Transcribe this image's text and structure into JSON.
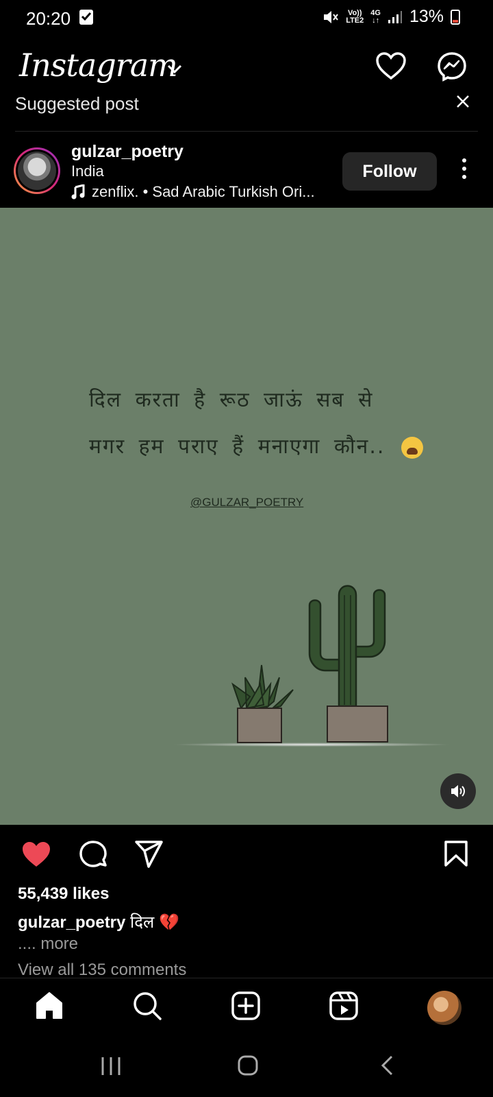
{
  "status_bar": {
    "time": "20:20",
    "network_top": "Vo))",
    "network_bottom": "LTE2",
    "network_type": "4G",
    "battery": "13%"
  },
  "header": {
    "logo": "Instagram"
  },
  "suggested": {
    "label": "Suggested post"
  },
  "post": {
    "username": "gulzar_poetry",
    "location": "India",
    "music": "zenflix. • Sad Arabic Turkish Ori...",
    "follow_label": "Follow",
    "poem_line1": "दिल करता है रूठ जाऊं सब से",
    "poem_line2": "मगर हम पराए हैं मनाएगा कौन..",
    "handle": "@GULZAR_POETRY",
    "likes": "55,439 likes",
    "caption_user": "gulzar_poetry",
    "caption_text": "दिल 💔",
    "more": ".... more",
    "comments": "View all 135 comments",
    "liked": true
  },
  "colors": {
    "post_bg": "#6b7f69",
    "like_red": "#ed4956",
    "follow_bg": "#262626"
  },
  "bottom_nav": {
    "items": [
      "home-icon",
      "search-icon",
      "create-icon",
      "reels-icon",
      "profile-avatar"
    ]
  }
}
